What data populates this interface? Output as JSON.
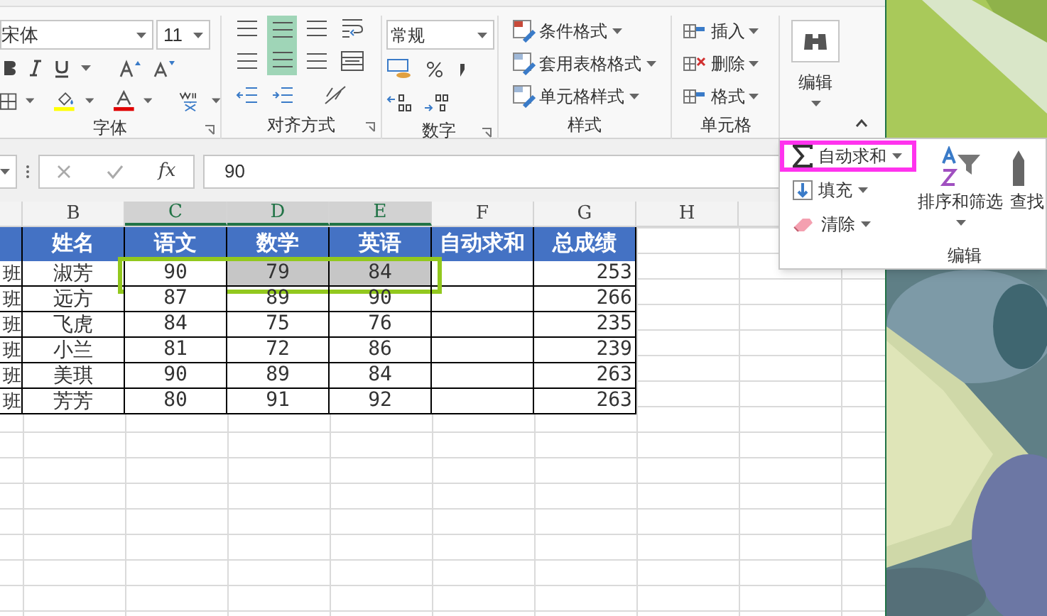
{
  "ribbon": {
    "font_group": {
      "font_name": "宋体",
      "font_size": "11",
      "label": "字体"
    },
    "alignment_group": {
      "label": "对齐方式",
      "middle_center_selected": true
    },
    "number_group": {
      "format": "常规",
      "label": "数字"
    },
    "styles_group": {
      "items": [
        "条件格式",
        "套用表格格式",
        "单元格样式"
      ],
      "label": "样式"
    },
    "cells_group": {
      "items": [
        "插入",
        "删除",
        "格式"
      ],
      "label": "单元格"
    },
    "editing_button": {
      "label": "编辑"
    }
  },
  "formula_bar": {
    "function_button": "fx",
    "value": "90"
  },
  "columns": [
    {
      "label": "B",
      "selected": false
    },
    {
      "label": "C",
      "selected": true
    },
    {
      "label": "D",
      "selected": true
    },
    {
      "label": "E",
      "selected": true
    },
    {
      "label": "F",
      "selected": false
    },
    {
      "label": "G",
      "selected": false
    },
    {
      "label": "H",
      "selected": false
    }
  ],
  "header_row": {
    "name": "姓名",
    "chinese": "语文",
    "math": "数学",
    "english": "英语",
    "auto_sum": "自动求和",
    "total": "总成绩"
  },
  "rows": [
    {
      "column_a": "班",
      "name": "淑芳",
      "chinese": "90",
      "math": "79",
      "english": "84",
      "total": "253",
      "selected": true
    },
    {
      "column_a": "班",
      "name": "远方",
      "chinese": "87",
      "math": "89",
      "english": "90",
      "total": "266",
      "selected": false
    },
    {
      "column_a": "班",
      "name": "飞虎",
      "chinese": "84",
      "math": "75",
      "english": "76",
      "total": "235",
      "selected": false
    },
    {
      "column_a": "班",
      "name": "小兰",
      "chinese": "81",
      "math": "72",
      "english": "86",
      "total": "239",
      "selected": false
    },
    {
      "column_a": "班",
      "name": "美琪",
      "chinese": "90",
      "math": "89",
      "english": "84",
      "total": "263",
      "selected": false
    },
    {
      "column_a": "班",
      "name": "芳芳",
      "chinese": "80",
      "math": "91",
      "english": "92",
      "total": "263",
      "selected": false
    }
  ],
  "editing_menu": {
    "items": [
      {
        "kind": "autosum",
        "label": "自动求和",
        "highlighted": true
      },
      {
        "kind": "fill",
        "label": "填充",
        "highlighted": false
      },
      {
        "kind": "clear",
        "label": "清除",
        "highlighted": false
      }
    ],
    "sort_filter": "排序和筛选",
    "find_select": "查找",
    "label": "编辑"
  }
}
